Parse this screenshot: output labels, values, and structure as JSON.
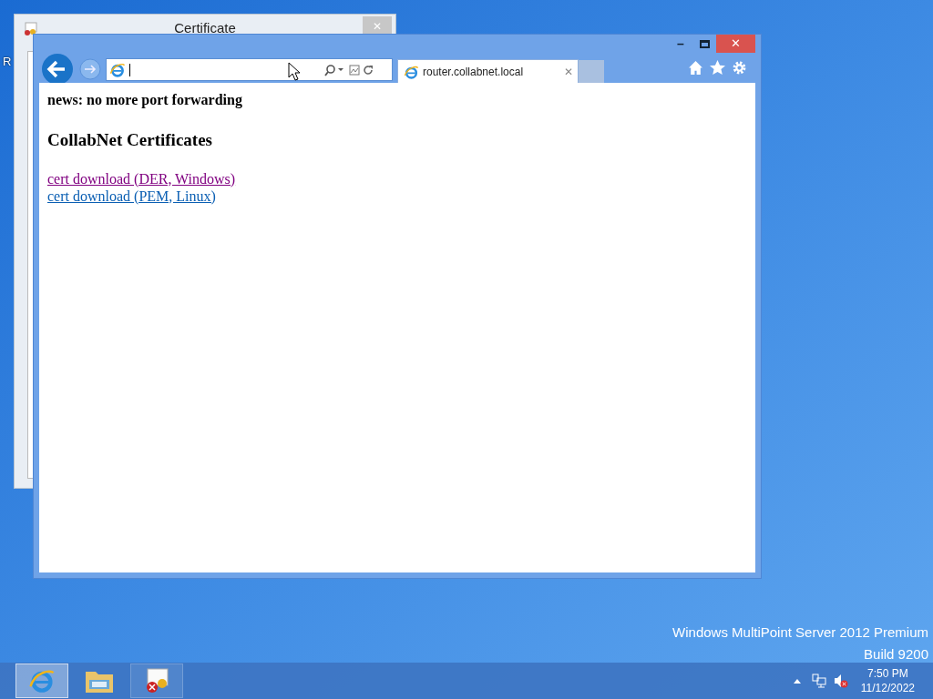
{
  "desktop": {
    "icon_label": "R",
    "edition": "Windows MultiPoint Server 2012 Premium",
    "build": "Build 9200"
  },
  "certificate_window": {
    "title": "Certificate",
    "close": "✕"
  },
  "browser": {
    "window_controls": {
      "minimize": "–",
      "close": "✕"
    },
    "tab": {
      "title": "router.collabnet.local",
      "close": "✕",
      "selected": true
    },
    "page": {
      "news": "news: no more port forwarding",
      "heading": "CollabNet Certificates",
      "links": [
        {
          "text": "cert download (DER, Windows)",
          "visited": true
        },
        {
          "text": "cert download (PEM, Linux)",
          "visited": false
        }
      ]
    }
  },
  "taskbar": {
    "apps": [
      {
        "kind": "browser",
        "selected": true
      },
      {
        "kind": "folder",
        "selected": false
      },
      {
        "kind": "certificate",
        "selected": false
      }
    ],
    "time": "7:50 PM",
    "date": "11/12/2022"
  }
}
